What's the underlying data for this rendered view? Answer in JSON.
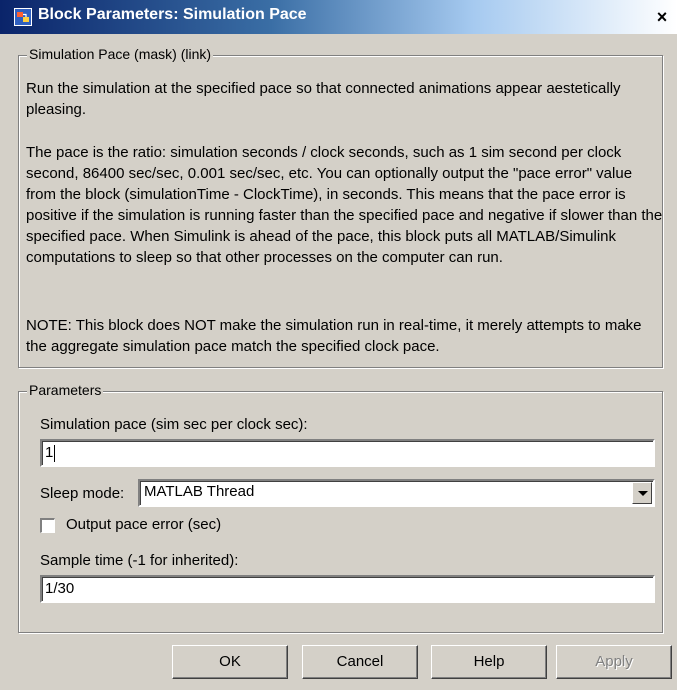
{
  "window": {
    "title": "Block Parameters: Simulation Pace",
    "close_glyph": "×"
  },
  "mask": {
    "group_label": "Simulation Pace (mask) (link)",
    "paragraphs": [
      "Run the simulation at the specified pace so that connected animations appear aestetically pleasing.",
      "The pace is the ratio: simulation seconds / clock seconds, such as 1 sim second per clock second, 86400 sec/sec, 0.001 sec/sec, etc.  You can optionally output the \"pace error\" value from the block (simulationTime - ClockTime), in seconds.  This means that the pace error is positive if the simulation is running faster than the specified pace and negative if slower than the specified pace.  When Simulink is ahead of the pace, this block puts all MATLAB/Simulink computations to sleep so that other processes on the computer can run.",
      "NOTE:  This block does NOT make the simulation run in real-time, it merely attempts to make the aggregate simulation pace match the specified clock pace."
    ]
  },
  "parameters": {
    "group_label": "Parameters",
    "pace_label": "Simulation pace (sim sec per clock sec):",
    "pace_value": "1",
    "sleep_mode_label": "Sleep mode:",
    "sleep_mode_value": "MATLAB Thread",
    "output_pace_error_label": "Output pace error (sec)",
    "output_pace_error_checked": false,
    "sample_time_label": "Sample time (-1 for inherited):",
    "sample_time_value": "1/30"
  },
  "buttons": {
    "ok": "OK",
    "cancel": "Cancel",
    "help": "Help",
    "apply": "Apply"
  },
  "colors": {
    "dialog_bg": "#d4d0c8",
    "title_bar": "#0a246a"
  },
  "icons": {
    "app": "simulink-block-icon",
    "close": "close-icon",
    "dropdown": "chevron-down-icon"
  }
}
